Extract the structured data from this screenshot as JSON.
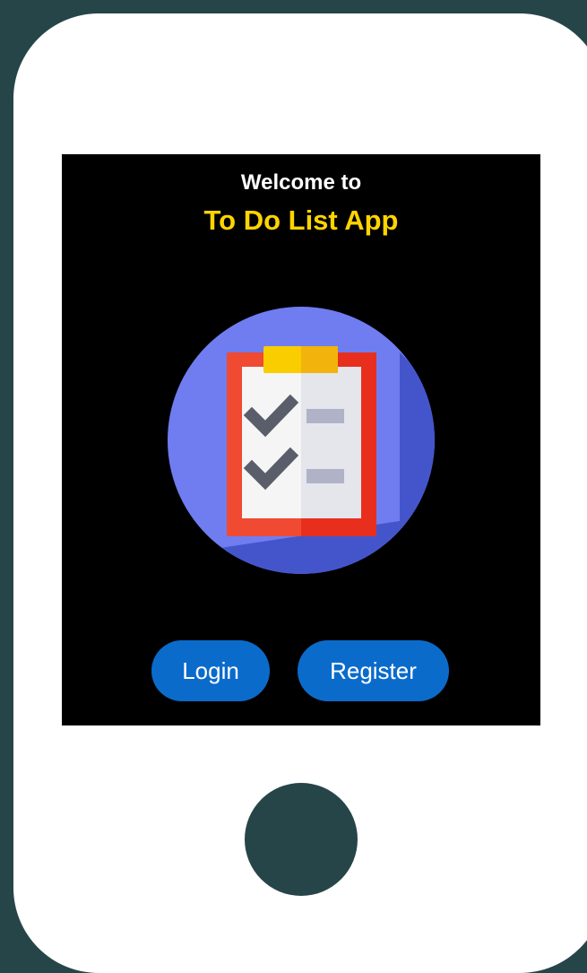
{
  "welcome": {
    "line1": "Welcome to",
    "app_name": "To Do List App"
  },
  "logo": {
    "icon": "clipboard-checklist-icon",
    "colors": {
      "circle": "#6f7df0",
      "circle_shadow": "#4455cc",
      "board_frame": "#f04a32",
      "paper": "#f4f4f4",
      "clip": "#f7c600",
      "check": "#5a5d6a",
      "line": "#b0b2c8"
    }
  },
  "actions": {
    "login_label": "Login",
    "register_label": "Register"
  },
  "colors": {
    "background": "#264548",
    "device": "#ffffff",
    "screen": "#000000",
    "title": "#ffffff",
    "accent": "#ffd400",
    "button": "#0b6bcb"
  }
}
